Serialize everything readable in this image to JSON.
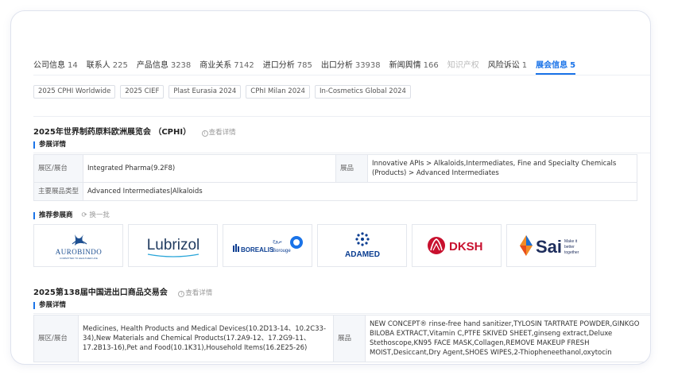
{
  "tabs": [
    {
      "label": "公司信息",
      "count": "14"
    },
    {
      "label": "联系人",
      "count": "225"
    },
    {
      "label": "产品信息",
      "count": "3238"
    },
    {
      "label": "商业关系",
      "count": "7142"
    },
    {
      "label": "进口分析",
      "count": "785"
    },
    {
      "label": "出口分析",
      "count": "33938"
    },
    {
      "label": "新闻舆情",
      "count": "166"
    },
    {
      "label": "知识产权",
      "count": ""
    },
    {
      "label": "风险诉讼",
      "count": "1"
    },
    {
      "label": "展会信息",
      "count": "5"
    }
  ],
  "chips": [
    "2025 CPHI Worldwide",
    "2025 CIEF",
    "Plast Eurasia 2024",
    "CPhI Milan 2024",
    "In-Cosmetics Global 2024"
  ],
  "detail_link": "查看详情",
  "sub_info_title": "参展详情",
  "label_booth": "展区/展台",
  "label_exhibits": "展品",
  "label_main_type": "主要展品类型",
  "recommend_title": "推荐参展商",
  "refresh_label": "换一批",
  "exhibition1": {
    "title": "2025年世界制药原料欧洲展览会 （CPHI）",
    "booth": "Integrated Pharma(9.2F8)",
    "exhibits": "Innovative APIs > Alkaloids,Intermediates, Fine and Specialty Chemicals (Products) > Advanced Intermediates",
    "main_type": "Advanced Intermediates|Alkaloids"
  },
  "logos": [
    {
      "name": "AUROBINDO",
      "tagline": "COMMITTED TO HEALTHIER LIFE"
    },
    {
      "name": "Lubrizol"
    },
    {
      "name": "BOREALIS",
      "partner": "Borouge"
    },
    {
      "name": "ADAMED"
    },
    {
      "name": "DKSH"
    },
    {
      "name": "Sai",
      "tagline1": "Make it",
      "tagline2": "better",
      "tagline3": "together"
    }
  ],
  "exhibition2": {
    "title": "2025第138届中国进出口商品交易会",
    "booth": "Medicines, Health Products and Medical Devices(10.2D13-14、10.2C33-34),New Materials and Chemical Products(17.2A9-12、17.2G9-11、17.2B13-16),Pet and Food(10.1K31),Household Items(16.2E25-26)",
    "exhibits": "NEW CONCEPT® rinse-free hand sanitizer,TYLOSIN TARTRATE POWDER,GINKGO BILOBA EXTRACT,Vitamin C,PTFE SKIVED SHEET,ginseng extract,Deluxe Stethoscope,KN95 FACE MASK,Collagen,REMOVE MAKEUP FRESH MOIST,Desiccant,Dry Agent,SHOES WIPES,2-Thiopheneethanol,oxytocin"
  },
  "colors": {
    "accent": "#1a73e8",
    "aurobindo": "#1d4f91",
    "lubrizol": "#1f3a5f",
    "borealis": "#0a3d91",
    "adamed": "#0a3d91",
    "dksh": "#c8102e",
    "sai": "#1d2d5c"
  }
}
